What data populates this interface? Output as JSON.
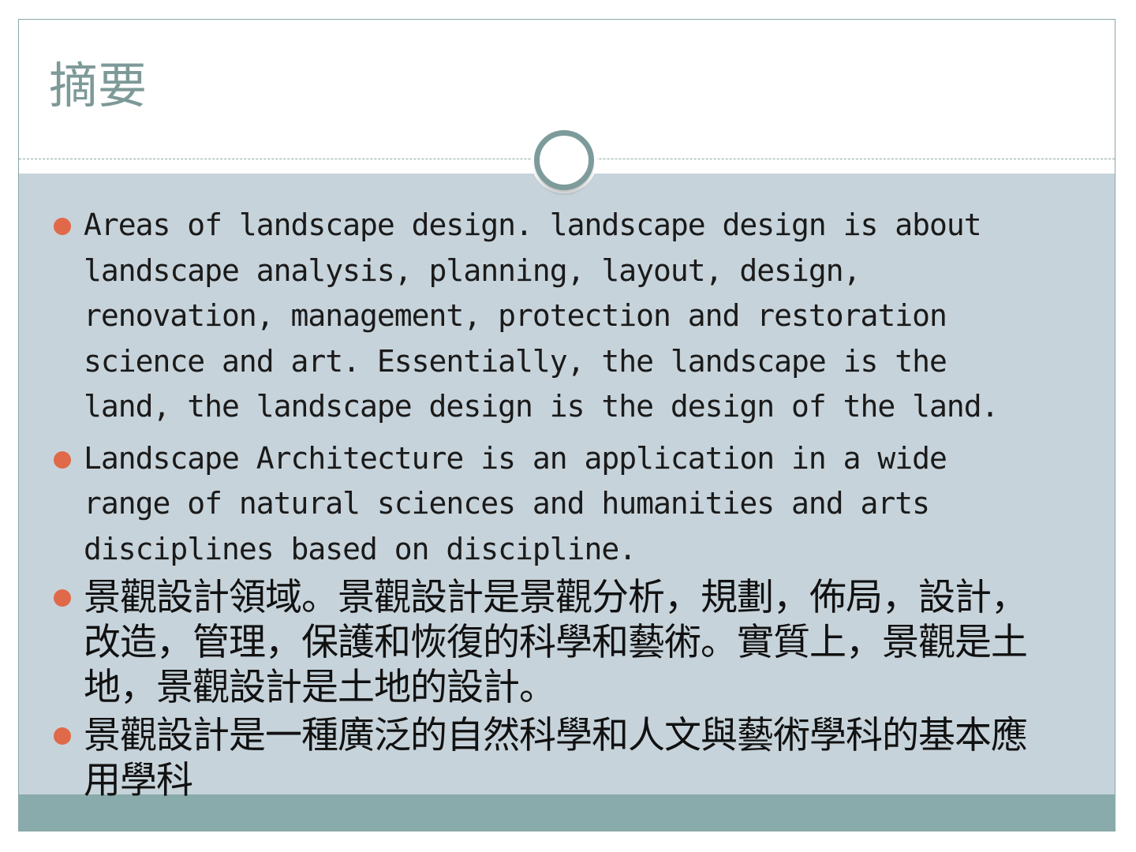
{
  "slide": {
    "title": "摘要",
    "bullets": [
      {
        "lines": [
          "Areas of landscape design. landscape design is about",
          "landscape analysis, planning, layout, design,",
          "renovation, management, protection and restoration",
          "science and art. Essentially, the landscape is the",
          "land, the landscape design is the design of the land."
        ]
      },
      {
        "lines": [
          "Landscape Architecture is an application in a wide",
          "range of natural sciences and humanities and arts",
          "disciplines based on discipline."
        ]
      },
      {
        "lines": [
          "景觀設計領域。景觀設計是景觀分析，規劃，佈局，設計，",
          "改造，管理，保護和恢復的科學和藝術。實質上，景觀是土",
          "地，景觀設計是土地的設計。"
        ]
      },
      {
        "lines": [
          "景觀設計是一種廣泛的自然科學和人文與藝術學科的基本應",
          "用學科"
        ]
      }
    ]
  },
  "colors": {
    "title": "#7d9998",
    "body_background": "#c7d3da",
    "footer_band": "#8aabab",
    "bullet_dot": "#e0694a",
    "ring": "#7d9b9b"
  }
}
